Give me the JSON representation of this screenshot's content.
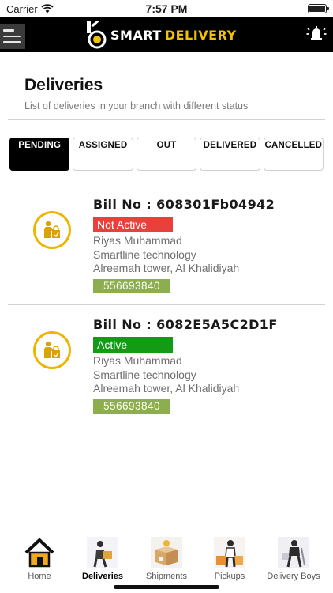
{
  "status_bar": {
    "carrier": "Carrier",
    "time": "7:57 PM"
  },
  "header": {
    "brand_smart": "SMART",
    "brand_delivery": "DELIVERY",
    "brand_color": "#f2c200",
    "menu_icon": "hamburger-icon",
    "alarm_icon": "alarm-bell-icon"
  },
  "page": {
    "title": "Deliveries",
    "subtitle": "List of deliveries in your branch with different status"
  },
  "tabs": [
    {
      "label": "PENDING",
      "active": true
    },
    {
      "label": "ASSIGNED",
      "active": false
    },
    {
      "label": "OUT",
      "active": false
    },
    {
      "label": "DELIVERED",
      "active": false
    },
    {
      "label": "CANCELLED",
      "active": false
    }
  ],
  "deliveries": [
    {
      "bill": "Bill No : 608301Fb04942",
      "status": "Not Active",
      "status_color": "#e8413c",
      "customer": "Riyas Muhammad",
      "company": "Smartline technology",
      "address": "Alreemah tower, Al Khalidiyah",
      "phone": "556693840"
    },
    {
      "bill": "Bill No : 6082E5A5C2D1F",
      "status": "Active",
      "status_color": "#149b16",
      "customer": "Riyas Muhammad",
      "company": "Smartline technology",
      "address": "Alreemah tower, Al Khalidiyah",
      "phone": "556693840"
    }
  ],
  "tab_bar": [
    {
      "label": "Home",
      "icon": "home-icon",
      "current": false
    },
    {
      "label": "Deliveries",
      "icon": "delivery-man-icon",
      "current": true
    },
    {
      "label": "Shipments",
      "icon": "shipment-box-icon",
      "current": false
    },
    {
      "label": "Pickups",
      "icon": "pickup-icon",
      "current": false
    },
    {
      "label": "Delivery Boys",
      "icon": "delivery-boy-icon",
      "current": false
    }
  ]
}
